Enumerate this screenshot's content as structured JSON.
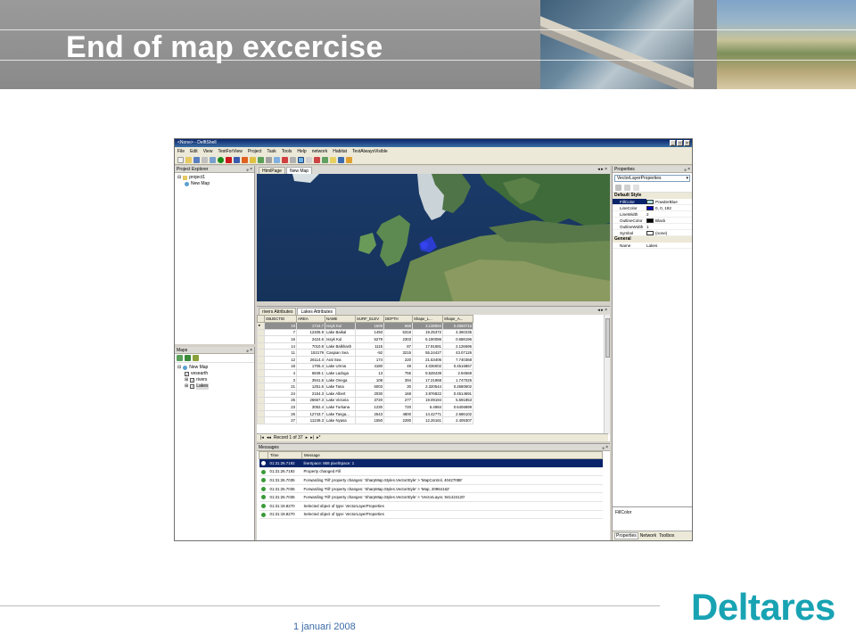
{
  "slide": {
    "title": "End of map excercise",
    "date": "1 januari 2008",
    "logo": "Deltares"
  },
  "app": {
    "window_title": "<None> - DelftShell",
    "menu": [
      "File",
      "Edit",
      "View",
      "TestForView",
      "Project",
      "Task",
      "Tools",
      "Help",
      "network",
      "Habitat",
      "TestAlwaysVisible"
    ],
    "project_explorer": {
      "title": "Project Explorer",
      "items": [
        "project1",
        "New Map"
      ]
    },
    "maps_panel": {
      "title": "Maps",
      "root": "New Map",
      "layers": [
        "vesearth",
        "rivers",
        "Lakes"
      ]
    },
    "doc_tabs": [
      "HtmlPage",
      "New Map"
    ],
    "attr_tabs": [
      "rivers Attributes",
      "Lakes Attributes"
    ],
    "attribute_table": {
      "columns": [
        "OBJECTID",
        "AREA",
        "NAME",
        "SURF_ELEV",
        "DEPTH",
        "Shape_L...",
        "Shape_A..."
      ],
      "rows": [
        [
          "19",
          "1744.7",
          "Issyk Kul",
          "1609",
          "668",
          "3.138894",
          "0.4560715"
        ],
        [
          "7",
          "12405.9",
          "Lake Baikal",
          "1493",
          "5318",
          "19.25372",
          "4.360235"
        ],
        [
          "16",
          "2424.6",
          "Issyk Kul",
          "5279",
          "2303",
          "5.190086",
          "0.688196"
        ],
        [
          "14",
          "7010.8",
          "Lake Balkhash",
          "1115",
          "87",
          "17.91681",
          "2.126696"
        ],
        [
          "11",
          "153179",
          "Caspian Sea",
          "-92",
          "3215",
          "55.24427",
          "43.07126"
        ],
        [
          "12",
          "26114.4",
          "Aral Sea",
          "174",
          "220",
          "21.53406",
          "7.740368"
        ],
        [
          "18",
          "1706.4",
          "Lake Urmia",
          "4180",
          "49",
          "4.036002",
          "0.4516867"
        ],
        [
          "4",
          "6849.1",
          "Lake Ladoga",
          "13",
          "755",
          "9.528439",
          "2.94569"
        ],
        [
          "3",
          "3941.6",
          "Lake Onega",
          "108",
          "394",
          "17.21968",
          "1.747025"
        ],
        [
          "21",
          "1251.6",
          "Lake Tana",
          "6003",
          "30",
          "2.320544",
          "0.2680602"
        ],
        [
          "24",
          "2154.3",
          "Lake Albert",
          "2030",
          "168",
          "3.876822",
          "0.4514691"
        ],
        [
          "25",
          "26667.3",
          "Lake Victoria",
          "3720",
          "277",
          "19.09194",
          "5.591853"
        ],
        [
          "23",
          "3052.4",
          "Lake Turkana",
          "1230",
          "720",
          "5.4984",
          "0.6406899"
        ],
        [
          "26",
          "12743.7",
          "Lake Tanga...",
          "2543",
          "4800",
          "14.42771",
          "2.686102"
        ],
        [
          "27",
          "11249.3",
          "Lake Nyasa",
          "1550",
          "2280",
          "12.26161",
          "2.409307"
        ]
      ],
      "record_label": "Record 1 of 37"
    },
    "messages": {
      "title": "Messages",
      "columns": [
        "",
        "Time",
        "Message"
      ],
      "rows": [
        [
          "01:31:26.7192",
          "lineSpace: 868 pixelSpace: 1"
        ],
        [
          "01:31:26.7192",
          "Property changed Fill"
        ],
        [
          "01:31:26.7035",
          "Forwarding 'Fill' property changes: 'SharpMap.Styles.VectorStyle' > 'MapControl, 40427088'"
        ],
        [
          "01:31:26.7035",
          "Forwarding 'Fill' property changes: 'SharpMap.Styles.VectorStyle' > 'Map, 20964162'"
        ],
        [
          "01:31:26.7035",
          "Forwarding 'Fill' property changes: 'SharpMap.Styles.VectorStyle' > 'VectorLayer, 941424120'"
        ],
        [
          "01:31:19.8270",
          "Selected object of type: VectorLayerProperties"
        ],
        [
          "01:31:19.8270",
          "Selected object of type: VectorLayerProperties"
        ]
      ]
    },
    "properties": {
      "title": "Properties",
      "selected_object": "VectorLayerProperties",
      "categories": [
        {
          "name": "Default Style",
          "rows": [
            {
              "key": "FillColor",
              "value": "PowderBlue",
              "swatch": "#b0e0e6"
            },
            {
              "key": "LineColor",
              "value": "0, 0, 192",
              "swatch": "#0000c0"
            },
            {
              "key": "LineWidth",
              "value": "2",
              "swatch": ""
            },
            {
              "key": "OutlineColor",
              "value": "Black",
              "swatch": "#000000"
            },
            {
              "key": "OutlineWidth",
              "value": "1",
              "swatch": ""
            },
            {
              "key": "Symbol",
              "value": "(none)",
              "swatch": "#ffffff"
            }
          ]
        },
        {
          "name": "General",
          "rows": [
            {
              "key": "Name",
              "value": "Lakes",
              "swatch": ""
            }
          ]
        }
      ],
      "description": "FillColor",
      "bottom_tabs": [
        "Properties",
        "Network",
        "Toolbox"
      ]
    }
  }
}
